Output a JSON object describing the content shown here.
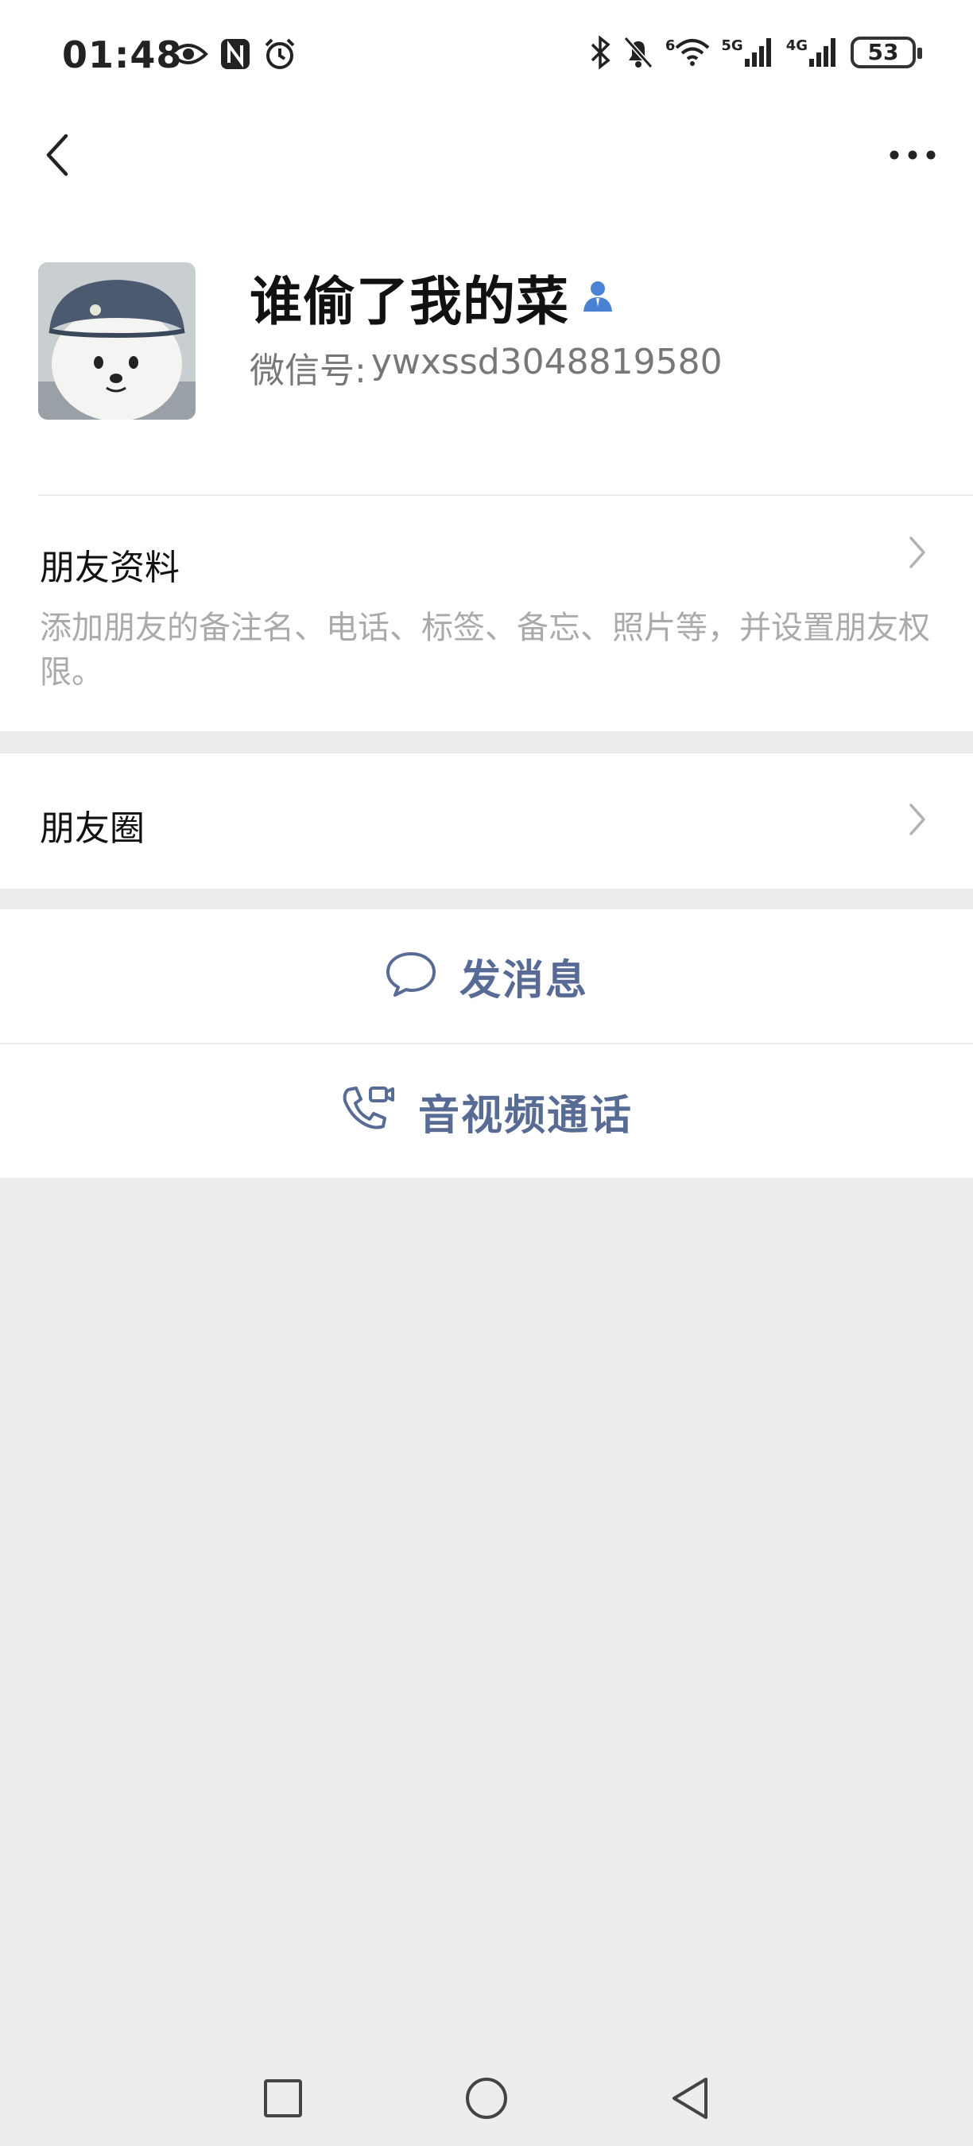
{
  "status_bar": {
    "time": "01:48",
    "net_6": "6",
    "net_5g": "5G",
    "net_4g": "4G",
    "battery": "53"
  },
  "nav": {
    "back_icon": "chevron-left-icon",
    "more_icon": "more-icon"
  },
  "profile": {
    "name": "谁偷了我的菜",
    "wechat_id_label": "微信号:",
    "wechat_id_value": "ywxssd3048819580"
  },
  "friend_info": {
    "title": "朋友资料",
    "description": "添加朋友的备注名、电话、标签、备忘、照片等，并设置朋友权限。"
  },
  "moments": {
    "title": "朋友圈"
  },
  "actions": {
    "message_label": "发消息",
    "call_label": "音视频通话"
  },
  "colors": {
    "accent": "#576b95",
    "icon_blue": "#4a82d3",
    "background": "#ededed"
  }
}
